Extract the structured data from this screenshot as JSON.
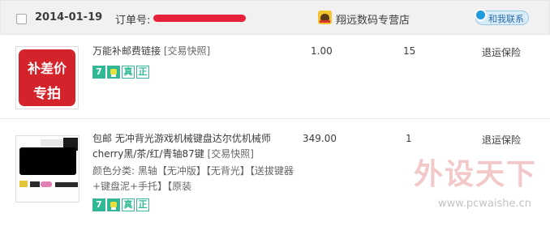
{
  "order": {
    "date": "2014-01-19",
    "order_no_label": "订单号:",
    "shop_name": "翔远数码专营店",
    "contact_label": "和我联系"
  },
  "items": [
    {
      "thumb_text_line1": "补差价",
      "thumb_text_line2": "专拍",
      "title": "万能补邮费链接",
      "snapshot": "[交易快照]",
      "price": "1.00",
      "qty": "15",
      "service": "退运保险",
      "badges": [
        "7",
        "",
        "真",
        "正"
      ]
    },
    {
      "title": "包邮 无冲背光游戏机械键盘达尔优机械师cherry黑/茶/红/青轴87键",
      "snapshot": "[交易快照]",
      "sku": "颜色分类: 黑轴【无冲版】【无背光】【送拔键器+键盘泥+手托】【原装",
      "price": "349.00",
      "qty": "1",
      "service": "退运保险",
      "badges": [
        "7",
        "",
        "真",
        "正"
      ]
    }
  ],
  "watermark": {
    "main": "外设天下",
    "url": "www.pcwaishe.cn"
  },
  "colors": {
    "header_bg": "#f1f1f1",
    "badge_green": "#2fb993",
    "stamp_red": "#d4232a",
    "redaction_red": "#e8213a"
  }
}
